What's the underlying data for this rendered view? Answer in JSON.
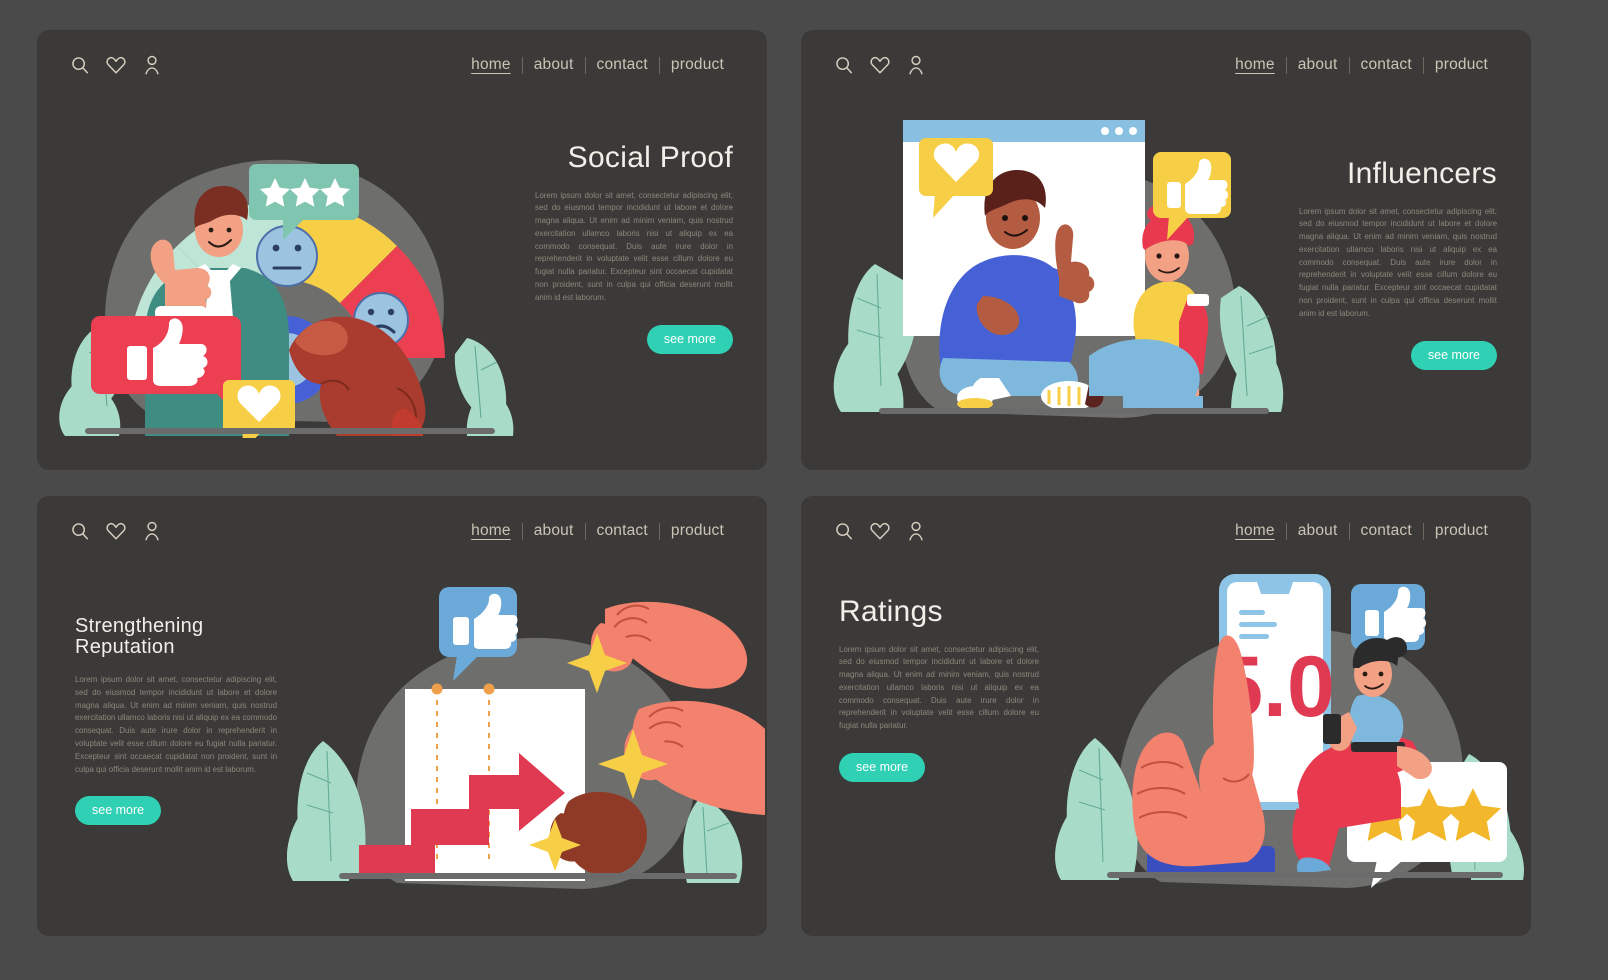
{
  "theme": {
    "page_bg": "#4a4a4a",
    "card_bg": "#3b3a38",
    "title_color": "#f2efe9",
    "body_color": "#8e877c",
    "nav_color": "#cbc3b5",
    "button_bg": "#2fd0b4",
    "button_text": "#ffffff",
    "accent_red": "#e8394f",
    "accent_yellow": "#f7cf46",
    "accent_mint": "#a8dcc8",
    "accent_blue": "#4661d6",
    "accent_skin": "#f2816d"
  },
  "nav": {
    "icons": [
      "search-icon",
      "heart-icon",
      "user-icon"
    ],
    "links": [
      {
        "label": "home",
        "active": true
      },
      {
        "label": "about",
        "active": false
      },
      {
        "label": "contact",
        "active": false
      },
      {
        "label": "product",
        "active": false
      }
    ]
  },
  "button": {
    "label": "see more"
  },
  "panels": [
    {
      "id": "social-proof",
      "title": "Social Proof",
      "title_size": "big",
      "text_side": "right",
      "body": "Lorem ipsum dolor sit amet, consectetur adipiscing elit, sed do eiusmod tempor incididunt ut labore et dolore magna aliqua. Ut enim ad minim veniam, quis nostrud exercitation ullamco laboris nisi ut aliquip ex ea commodo consequat. Duis aute irure dolor in reprehenderit in voluptate velit esse cillum dolore eu fugiat nulla pariatur. Excepteur sint occaecat cupidatat non proident, sunt in culpa qui officia deserunt mollit anim id est laborum.",
      "illustration": "satisfaction-gauge-with-man-and-reactions",
      "elements": [
        "three-star-bubble",
        "thumbs-up-bubble",
        "heart-bubble",
        "happy-face",
        "neutral-face",
        "sad-face",
        "pointing-hand"
      ]
    },
    {
      "id": "influencers",
      "title": "Influencers",
      "title_size": "big",
      "text_side": "right",
      "body": "Lorem ipsum dolor sit amet, consectetur adipiscing elit, sed do eiusmod tempor incididunt ut labore et dolore magna aliqua. Ut enim ad minim veniam, quis nostrud exercitation ullamco laboris nisi ut aliquip ex ea commodo consequat. Duis aute irure dolor in reprehenderit in voluptate velit esse cillum dolore eu fugiat nulla pariatur. Excepteur sint occaecat cupidatat non proident, sunt in culpa qui officia deserunt mollit anim id est laborum.",
      "illustration": "two-seated-people-streaming-window",
      "elements": [
        "browser-window",
        "heart-bubble",
        "thumbs-up-bubble",
        "seated-man-blue",
        "seated-man-yellow"
      ]
    },
    {
      "id": "strengthening-reputation",
      "title": "Strengthening Reputation",
      "title_size": "med",
      "text_side": "left",
      "body": "Lorem ipsum dolor sit amet, consectetur adipiscing elit, sed do eiusmod tempor incididunt ut labore et dolore magna aliqua. Ut enim ad minim veniam, quis nostrud exercitation ullamco laboris nisi ut aliquip ex ea commodo consequat. Duis aute irure dolor in reprehenderit in voluptate velit esse cillum dolore eu fugiat nulla pariatur. Excepteur sint occaecat cupidatat non proident, sunt in culpa qui officia deserunt mollit anim id est laborum.",
      "illustration": "rising-arrow-chart-with-hands-and-sparkles",
      "elements": [
        "thumbs-up-bubble",
        "growth-chart",
        "rising-arrow",
        "sparkle-star",
        "hand-holding-star"
      ]
    },
    {
      "id": "ratings",
      "title": "Ratings",
      "title_size": "big",
      "text_side": "left",
      "body": "Lorem ipsum dolor sit amet, consectetur adipiscing elit, sed do eiusmod tempor incididunt ut labore et dolore magna aliqua. Ut enim ad minim veniam, quis nostrud exercitation ullamco laboris nisi ut aliquip ex ea commodo consequat. Duis aute irure dolor in reprehenderit in voluptate velit esse cillum dolore eu fugiat nulla pariatur.",
      "illustration": "phone-five-point-zero-rating-with-hand",
      "rating_value": "5.0",
      "star_count": 3,
      "elements": [
        "smartphone",
        "pointing-hand",
        "thumbs-up-bubble",
        "woman-with-phone",
        "three-star-bubble"
      ]
    }
  ]
}
